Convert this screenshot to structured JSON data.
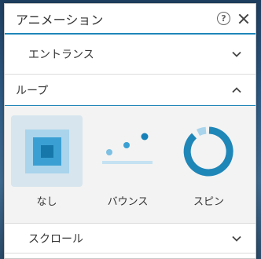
{
  "window": {
    "title": "アニメーション"
  },
  "sections": {
    "entrance": {
      "label": "エントランス",
      "state": "collapsed"
    },
    "loop": {
      "label": "ループ",
      "state": "expanded"
    },
    "scroll": {
      "label": "スクロール",
      "state": "collapsed"
    }
  },
  "loop_options": [
    {
      "label": "なし",
      "icon": "none-squares-icon",
      "selected": true
    },
    {
      "label": "バウンス",
      "icon": "bounce-dots-icon",
      "selected": false
    },
    {
      "label": "スピン",
      "icon": "spin-ring-icon",
      "selected": false
    }
  ],
  "colors": {
    "accent": "#1f86b8",
    "light_blue": "#a9d4ec",
    "selected_bg": "#d7e5ee"
  }
}
